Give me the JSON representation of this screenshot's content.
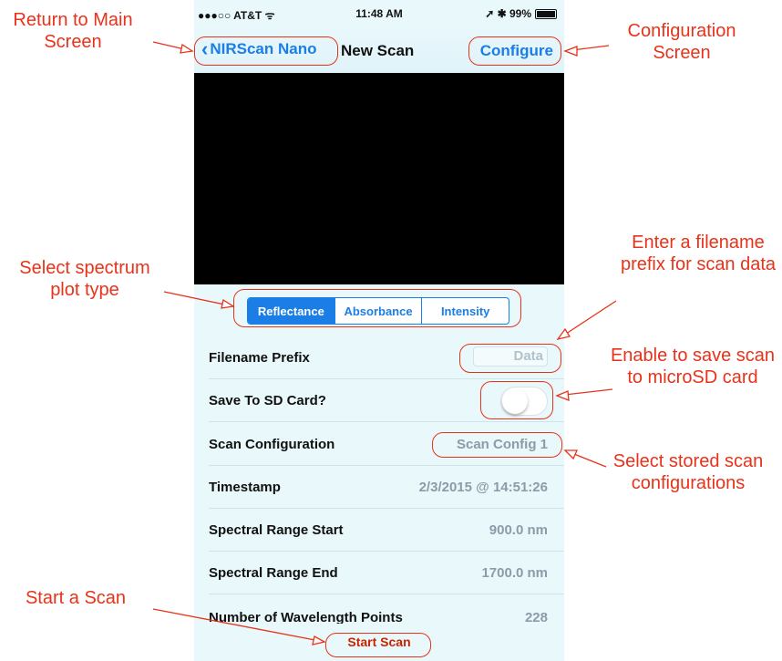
{
  "status_bar": {
    "carrier": "●●●○○ AT&T ᯤ",
    "time": "11:48 AM",
    "indicators": "➚ ✱ 99%"
  },
  "nav": {
    "back_label": "NIRScan Nano",
    "title": "New Scan",
    "configure_label": "Configure"
  },
  "plot_type": {
    "options": [
      "Reflectance",
      "Absorbance",
      "Intensity"
    ],
    "selected": "Reflectance"
  },
  "rows": {
    "filename_prefix": {
      "label": "Filename Prefix",
      "placeholder": "Data"
    },
    "save_sd": {
      "label": "Save To SD Card?",
      "enabled": false
    },
    "scan_config": {
      "label": "Scan Configuration",
      "value": "Scan Config 1"
    },
    "timestamp": {
      "label": "Timestamp",
      "value": "2/3/2015 @ 14:51:26"
    },
    "range_start": {
      "label": "Spectral Range Start",
      "value": "900.0 nm"
    },
    "range_end": {
      "label": "Spectral Range End",
      "value": "1700.0 nm"
    },
    "wavelength_points": {
      "label": "Number of Wavelength Points",
      "value": "228"
    }
  },
  "start_scan_label": "Start Scan",
  "annotations": {
    "return": "Return to Main Screen",
    "configuration": "Configuration Screen",
    "plot_type": "Select spectrum plot type",
    "filename": "Enter a filename prefix for scan data",
    "sd_card": "Enable to save scan to microSD card",
    "stored_configs": "Select stored scan configurations",
    "start": "Start a Scan"
  },
  "colors": {
    "accent": "#1a7ee6",
    "annotation": "#e8321a",
    "background": "#e9f8fb"
  }
}
